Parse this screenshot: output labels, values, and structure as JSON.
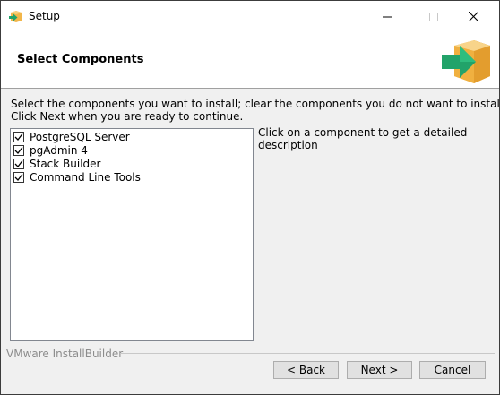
{
  "window": {
    "title": "Setup",
    "icon": "setup-box-icon"
  },
  "header": {
    "title": "Select Components",
    "logo": "setup-box-icon"
  },
  "instructions": {
    "line1": "Select the components you want to install; clear the components you do not want to install.",
    "line2": "Click Next when you are ready to continue."
  },
  "components": [
    {
      "label": "PostgreSQL Server",
      "checked": true
    },
    {
      "label": "pgAdmin 4",
      "checked": true
    },
    {
      "label": "Stack Builder",
      "checked": true
    },
    {
      "label": "Command Line Tools",
      "checked": true
    }
  ],
  "description": "Click on a component to get a detailed description",
  "footer": {
    "brand": "VMware InstallBuilder"
  },
  "buttons": {
    "back": "< Back",
    "next": "Next >",
    "cancel": "Cancel"
  },
  "colors": {
    "box_orange": "#f2b64a",
    "arrow_green": "#22a36a"
  }
}
